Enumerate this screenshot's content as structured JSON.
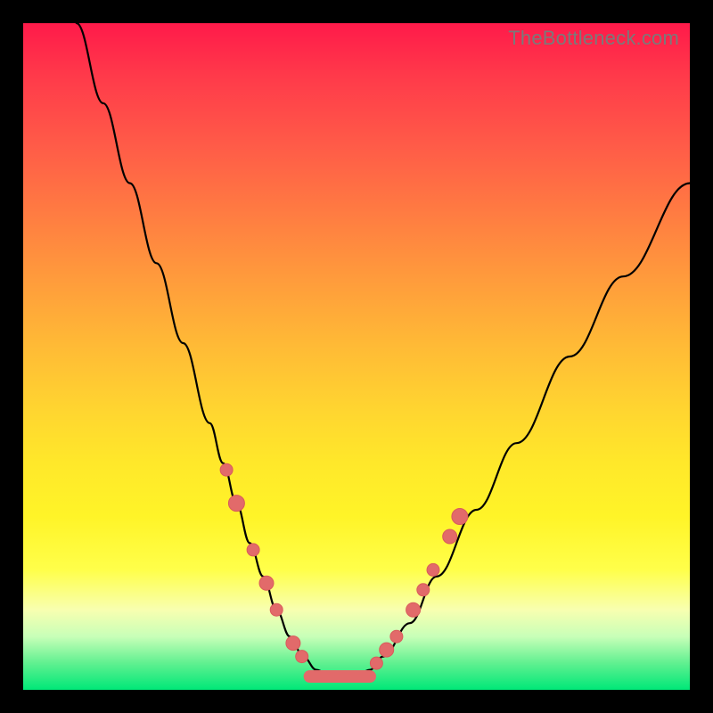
{
  "watermark": "TheBottleneck.com",
  "colors": {
    "frame_bg_top": "#ff1a4a",
    "frame_bg_bottom": "#00e878",
    "curve": "#000000",
    "marker_fill": "#e26a6a",
    "marker_stroke": "#d95b5b",
    "page_bg": "#000000"
  },
  "chart_data": {
    "type": "line",
    "title": "",
    "xlabel": "",
    "ylabel": "",
    "xlim": [
      0,
      100
    ],
    "ylim": [
      0,
      100
    ],
    "grid": false,
    "series": [
      {
        "name": "bottleneck-curve",
        "x": [
          8,
          12,
          16,
          20,
          24,
          28,
          30,
          32,
          34,
          36,
          38,
          40,
          42,
          44,
          46,
          48,
          50,
          52,
          54,
          58,
          62,
          68,
          74,
          82,
          90,
          100
        ],
        "y": [
          100,
          88,
          76,
          64,
          52,
          40,
          34,
          28,
          22,
          17,
          12,
          8,
          5,
          3,
          2,
          2,
          2,
          3,
          5,
          10,
          17,
          27,
          37,
          50,
          62,
          76
        ]
      }
    ],
    "markers": {
      "name": "highlight-points",
      "points": [
        {
          "x": 30.5,
          "y": 33,
          "r": 7
        },
        {
          "x": 32.0,
          "y": 28,
          "r": 9
        },
        {
          "x": 34.5,
          "y": 21,
          "r": 7
        },
        {
          "x": 36.5,
          "y": 16,
          "r": 8
        },
        {
          "x": 38.0,
          "y": 12,
          "r": 7
        },
        {
          "x": 40.5,
          "y": 7,
          "r": 8
        },
        {
          "x": 41.8,
          "y": 5,
          "r": 7
        },
        {
          "x": 53.0,
          "y": 4,
          "r": 7
        },
        {
          "x": 54.5,
          "y": 6,
          "r": 8
        },
        {
          "x": 56.0,
          "y": 8,
          "r": 7
        },
        {
          "x": 58.5,
          "y": 12,
          "r": 8
        },
        {
          "x": 60.0,
          "y": 15,
          "r": 7
        },
        {
          "x": 61.5,
          "y": 18,
          "r": 7
        },
        {
          "x": 64.0,
          "y": 23,
          "r": 8
        },
        {
          "x": 65.5,
          "y": 26,
          "r": 9
        }
      ]
    },
    "plateau": {
      "y": 2,
      "x_from": 43,
      "x_to": 52
    }
  }
}
